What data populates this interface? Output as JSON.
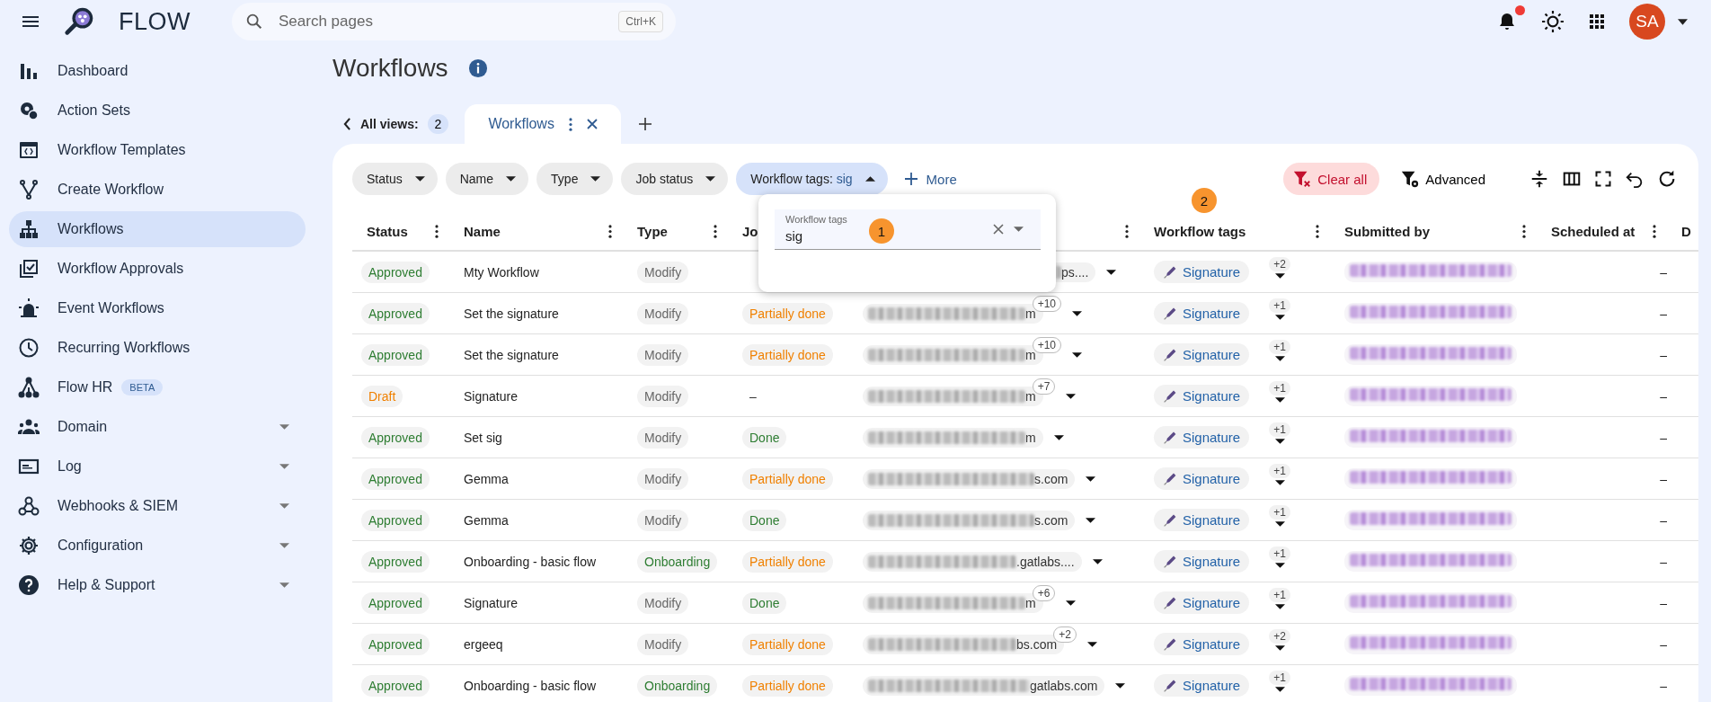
{
  "app": {
    "name": "FLOW"
  },
  "search": {
    "placeholder": "Search pages",
    "shortcut": "Ctrl+K"
  },
  "topbar": {
    "notification_dot": true,
    "avatar": "SA"
  },
  "sidebar": {
    "items": [
      {
        "label": "Dashboard",
        "selected": false,
        "expandable": false
      },
      {
        "label": "Action Sets",
        "selected": false,
        "expandable": false
      },
      {
        "label": "Workflow Templates",
        "selected": false,
        "expandable": false
      },
      {
        "label": "Create Workflow",
        "selected": false,
        "expandable": false
      },
      {
        "label": "Workflows",
        "selected": true,
        "expandable": false
      },
      {
        "label": "Workflow Approvals",
        "selected": false,
        "expandable": false
      },
      {
        "label": "Event Workflows",
        "selected": false,
        "expandable": false
      },
      {
        "label": "Recurring Workflows",
        "selected": false,
        "expandable": false
      },
      {
        "label": "Flow HR",
        "selected": false,
        "expandable": false,
        "badge": "BETA"
      },
      {
        "label": "Domain",
        "selected": false,
        "expandable": true
      },
      {
        "label": "Log",
        "selected": false,
        "expandable": true
      },
      {
        "label": "Webhooks & SIEM",
        "selected": false,
        "expandable": true
      },
      {
        "label": "Configuration",
        "selected": false,
        "expandable": true
      },
      {
        "label": "Help & Support",
        "selected": false,
        "expandable": true
      }
    ]
  },
  "page": {
    "title": "Workflows"
  },
  "views": {
    "label": "All views:",
    "count": "2",
    "tabs": [
      {
        "label": "Workflows",
        "selected": true
      }
    ]
  },
  "filters": [
    {
      "label": "Status",
      "open": false
    },
    {
      "label": "Name",
      "open": false
    },
    {
      "label": "Type",
      "open": false
    },
    {
      "label": "Job status",
      "open": false
    },
    {
      "label": "Workflow tags:",
      "value": "sig",
      "open": true
    }
  ],
  "more_button": "More",
  "clear_button": "Clear all",
  "advanced_button": "Advanced",
  "filter_popup": {
    "label": "Workflow tags",
    "value": "sig"
  },
  "annotations": [
    "1",
    "2"
  ],
  "table": {
    "columns": [
      "Status",
      "Name",
      "Type",
      "Jo",
      "",
      "Workflow tags",
      "Submitted by",
      "Scheduled at",
      "D"
    ],
    "rows": [
      {
        "status": {
          "text": "Approved",
          "color": "#2e7d32"
        },
        "name": "Mty Workflow",
        "type": {
          "text": "Modify",
          "color": "#666666"
        },
        "col5": {
          "suffix": "ps...."
        },
        "tag": {
          "label": "Signature",
          "more": "+2"
        },
        "scheduled": "–"
      },
      {
        "status": {
          "text": "Approved",
          "color": "#2e7d32"
        },
        "name": "Set the signature",
        "type": {
          "text": "Modify",
          "color": "#666666"
        },
        "job": {
          "text": "Partially done",
          "color": "#f08000"
        },
        "col5": {
          "suffix": "m",
          "more": "+10"
        },
        "tag": {
          "label": "Signature",
          "more": "+1"
        },
        "scheduled": "–"
      },
      {
        "status": {
          "text": "Approved",
          "color": "#2e7d32"
        },
        "name": "Set the signature",
        "type": {
          "text": "Modify",
          "color": "#666666"
        },
        "job": {
          "text": "Partially done",
          "color": "#f08000"
        },
        "col5": {
          "suffix": "m",
          "more": "+10"
        },
        "tag": {
          "label": "Signature",
          "more": "+1"
        },
        "scheduled": "–"
      },
      {
        "status": {
          "text": "Draft",
          "color": "#f08000"
        },
        "name": "Signature",
        "type": {
          "text": "Modify",
          "color": "#666666"
        },
        "job": {
          "text": "–"
        },
        "col5": {
          "suffix": "m",
          "more": "+7"
        },
        "tag": {
          "label": "Signature",
          "more": "+1"
        },
        "scheduled": "–"
      },
      {
        "status": {
          "text": "Approved",
          "color": "#2e7d32"
        },
        "name": "Set sig",
        "type": {
          "text": "Modify",
          "color": "#666666"
        },
        "job": {
          "text": "Done",
          "color": "#2e7d32"
        },
        "col5": {
          "suffix": "m"
        },
        "tag": {
          "label": "Signature",
          "more": "+1"
        },
        "scheduled": "–"
      },
      {
        "status": {
          "text": "Approved",
          "color": "#2e7d32"
        },
        "name": "Gemma",
        "type": {
          "text": "Modify",
          "color": "#666666"
        },
        "job": {
          "text": "Partially done",
          "color": "#f08000"
        },
        "col5": {
          "suffix": "s.com"
        },
        "tag": {
          "label": "Signature",
          "more": "+1"
        },
        "scheduled": "–"
      },
      {
        "status": {
          "text": "Approved",
          "color": "#2e7d32"
        },
        "name": "Gemma",
        "type": {
          "text": "Modify",
          "color": "#666666"
        },
        "job": {
          "text": "Done",
          "color": "#2e7d32"
        },
        "col5": {
          "suffix": "s.com"
        },
        "tag": {
          "label": "Signature",
          "more": "+1"
        },
        "scheduled": "–"
      },
      {
        "status": {
          "text": "Approved",
          "color": "#2e7d32"
        },
        "name": "Onboarding - basic flow",
        "type": {
          "text": "Onboarding",
          "color": "#2e7d32"
        },
        "job": {
          "text": "Partially done",
          "color": "#f08000"
        },
        "col5": {
          "suffix": ".gatlabs...."
        },
        "tag": {
          "label": "Signature",
          "more": "+1"
        },
        "scheduled": "–"
      },
      {
        "status": {
          "text": "Approved",
          "color": "#2e7d32"
        },
        "name": "Signature",
        "type": {
          "text": "Modify",
          "color": "#666666"
        },
        "job": {
          "text": "Done",
          "color": "#2e7d32"
        },
        "col5": {
          "suffix": "m",
          "more": "+6"
        },
        "tag": {
          "label": "Signature",
          "more": "+1"
        },
        "scheduled": "–"
      },
      {
        "status": {
          "text": "Approved",
          "color": "#2e7d32"
        },
        "name": "ergeeq",
        "type": {
          "text": "Modify",
          "color": "#666666"
        },
        "job": {
          "text": "Partially done",
          "color": "#f08000"
        },
        "col5": {
          "suffix": "bs.com",
          "more": "+2"
        },
        "tag": {
          "label": "Signature",
          "more": "+2"
        },
        "scheduled": "–"
      },
      {
        "status": {
          "text": "Approved",
          "color": "#2e7d32"
        },
        "name": "Onboarding - basic flow",
        "type": {
          "text": "Onboarding",
          "color": "#2e7d32"
        },
        "job": {
          "text": "Partially done",
          "color": "#f08000"
        },
        "col5": {
          "suffix": "gatlabs.com"
        },
        "tag": {
          "label": "Signature",
          "more": "+1"
        },
        "scheduled": "–"
      }
    ]
  }
}
